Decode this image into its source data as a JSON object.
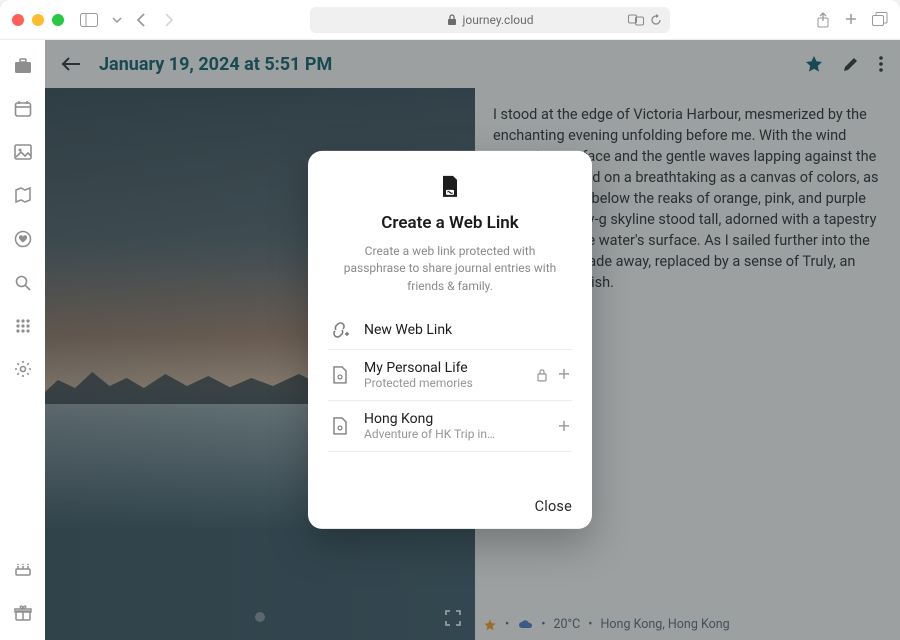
{
  "browser": {
    "url_host": "journey.cloud"
  },
  "entry": {
    "title": "January 19, 2024 at 5:51 PM",
    "body": "I stood at the edge of Victoria Harbour, mesmerized by the enchanting evening unfolding before me. With the wind caressing my face and the gentle waves lapping against the boat, I embarked on a breathtaking as a canvas of colors, as the sun dipped below the reaks of orange, pink, and purple across the heav-g skyline stood tall, adorned with a tapestry of twin-g off the water's surface. As I sailed further into the ity seemed to fade away, replaced by a sense of Truly, an evening to cherish."
  },
  "status": {
    "temp": "20°C",
    "location": "Hong Kong, Hong Kong",
    "dot": "•"
  },
  "modal": {
    "title": "Create a Web Link",
    "desc": "Create a web link protected with passphrase to share journal entries with friends & family.",
    "new_label": "New Web Link",
    "items": [
      {
        "title": "My Personal Life",
        "subtitle": "Protected memories",
        "locked": true
      },
      {
        "title": "Hong Kong",
        "subtitle": "Adventure of HK Trip in…",
        "locked": false
      }
    ],
    "close": "Close"
  }
}
